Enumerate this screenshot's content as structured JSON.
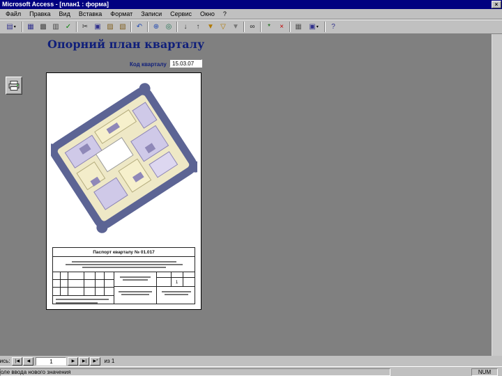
{
  "window": {
    "title": "Microsoft Access - [план1 : форма]",
    "close_glyph": "×"
  },
  "menu": {
    "items": [
      "Файл",
      "Правка",
      "Вид",
      "Вставка",
      "Формат",
      "Записи",
      "Сервис",
      "Окно",
      "?"
    ]
  },
  "toolbar": {
    "items": [
      {
        "t": "b",
        "name": "form-view-button",
        "g": "▤",
        "c": "#30308c",
        "dd": true
      },
      {
        "t": "s"
      },
      {
        "t": "b",
        "name": "save-button",
        "g": "▦",
        "c": "#30308c"
      },
      {
        "t": "b",
        "name": "print-button",
        "g": "▩",
        "c": "#444444"
      },
      {
        "t": "b",
        "name": "print-preview-button",
        "g": "▥",
        "c": "#444444"
      },
      {
        "t": "b",
        "name": "spelling-button",
        "g": "✓",
        "c": "#008000"
      },
      {
        "t": "s"
      },
      {
        "t": "b",
        "name": "cut-button",
        "g": "✂",
        "c": "#333333"
      },
      {
        "t": "b",
        "name": "copy-button",
        "g": "▣",
        "c": "#30308c"
      },
      {
        "t": "b",
        "name": "paste-button",
        "g": "▨",
        "c": "#806020"
      },
      {
        "t": "b",
        "name": "format-painter-button",
        "g": "▧",
        "c": "#806020"
      },
      {
        "t": "s"
      },
      {
        "t": "b",
        "name": "undo-button",
        "g": "↶",
        "c": "#2048b0"
      },
      {
        "t": "s"
      },
      {
        "t": "b",
        "name": "insert-hyperlink-button",
        "g": "⊕",
        "c": "#2048b0"
      },
      {
        "t": "b",
        "name": "web-toolbar-button",
        "g": "◎",
        "c": "#207050"
      },
      {
        "t": "s"
      },
      {
        "t": "b",
        "name": "sort-ascending-button",
        "g": "↓",
        "c": "#333333"
      },
      {
        "t": "b",
        "name": "sort-descending-button",
        "g": "↑",
        "c": "#333333"
      },
      {
        "t": "b",
        "name": "filter-by-selection-button",
        "g": "▼",
        "c": "#b07800"
      },
      {
        "t": "b",
        "name": "filter-by-form-button",
        "g": "▽",
        "c": "#b07800"
      },
      {
        "t": "b",
        "name": "apply-filter-button",
        "g": "▼",
        "c": "#777777"
      },
      {
        "t": "s"
      },
      {
        "t": "b",
        "name": "find-button",
        "g": "∞",
        "c": "#222222"
      },
      {
        "t": "s"
      },
      {
        "t": "b",
        "name": "new-record-button",
        "g": "*",
        "c": "#006000"
      },
      {
        "t": "b",
        "name": "delete-record-button",
        "g": "×",
        "c": "#c00000"
      },
      {
        "t": "s"
      },
      {
        "t": "b",
        "name": "database-window-button",
        "g": "▦",
        "c": "#555555"
      },
      {
        "t": "b",
        "name": "new-object-button",
        "g": "▣",
        "c": "#30308c",
        "dd": true
      },
      {
        "t": "s"
      },
      {
        "t": "b",
        "name": "help-button",
        "g": "?",
        "c": "#30308c"
      }
    ]
  },
  "form": {
    "heading": "Опорний план кварталу",
    "code_label": "Код кварталу",
    "code_value": "15.03.07",
    "stamp_title": "Паспорт кварталу № 01.017",
    "stamp_sheet": "1"
  },
  "record_nav": {
    "label": "Запись:",
    "left": [
      {
        "name": "first-record-button",
        "glyph": "|◀"
      },
      {
        "name": "previous-record-button",
        "glyph": "◀"
      }
    ],
    "value": "1",
    "right": [
      {
        "name": "next-record-button",
        "glyph": "▶"
      },
      {
        "name": "last-record-button",
        "glyph": "▶|"
      },
      {
        "name": "new-record-button",
        "glyph": "▶*"
      }
    ],
    "of": "из 1"
  },
  "status": {
    "message": "Поле ввода нового значения",
    "num": "NUM"
  },
  "colors": {
    "titlebar": "#000080",
    "title_text": "#ffffff",
    "face": "#c0c0c0",
    "shadow": "#808080",
    "page": "#ffffff",
    "accent": "#101f7a",
    "plan_border": "#5c6494",
    "plan_fill": "#eee8c6",
    "plan_bldg": "#cfc9e8",
    "plan_bldg_dark": "#8f88b8"
  }
}
